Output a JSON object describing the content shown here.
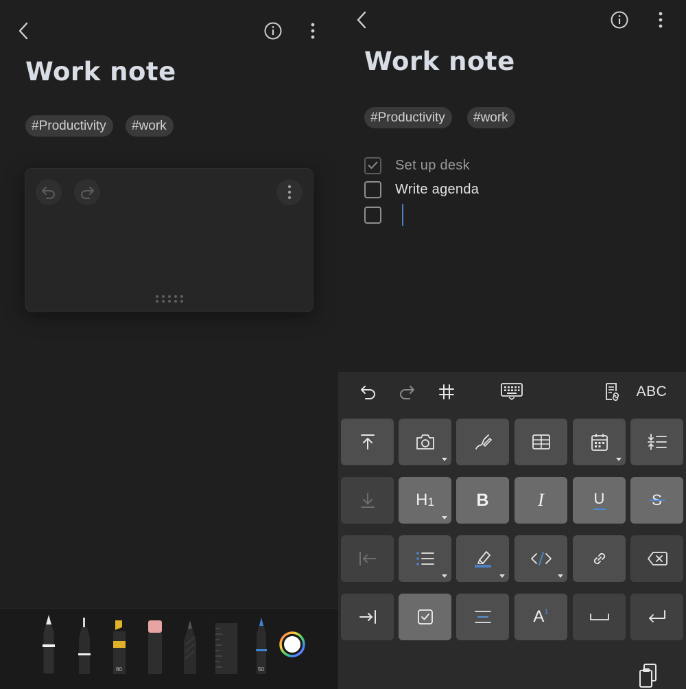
{
  "left_screen": {
    "title": "Work note",
    "tags": [
      "#Productivity",
      "#work"
    ],
    "icons": {
      "back": "back-arrow-icon",
      "info": "info-icon",
      "more": "more-vertical-icon",
      "undo": "undo-icon",
      "redo": "redo-icon",
      "canvas_more": "more-vertical-icon",
      "handle": "drag-handle-icon",
      "palette": "color-palette-icon"
    },
    "pens": [
      {
        "name": "fountain-pen",
        "number": ""
      },
      {
        "name": "fine-liner",
        "number": ""
      },
      {
        "name": "marker",
        "number": "80"
      },
      {
        "name": "eraser",
        "number": ""
      },
      {
        "name": "pencil",
        "number": ""
      },
      {
        "name": "ruler",
        "number": ""
      },
      {
        "name": "ballpoint-pen",
        "number": "50"
      }
    ],
    "colors": {
      "marker": "#e0b22a",
      "eraser": "#e8a3a3",
      "ballpoint": "#3d86d6"
    }
  },
  "right_screen": {
    "title": "Work note",
    "tags": [
      "#Productivity",
      "#work"
    ],
    "checklist": [
      {
        "label": "Set up desk",
        "checked": true
      },
      {
        "label": "Write agenda",
        "checked": false
      },
      {
        "label": "",
        "checked": false
      }
    ],
    "toolbar": {
      "abc_label": "ABC",
      "top_icons": [
        "undo-icon",
        "redo-icon",
        "grid-icon",
        "keyboard-icon",
        "note-link-icon"
      ]
    },
    "keys": {
      "h1_label": "H",
      "h1_sub": "1",
      "bold_label": "B",
      "italic_label": "I",
      "underline_label": "U",
      "strike_label": "S",
      "superscript_label": "A",
      "superscript_sup": "1"
    },
    "accent_color": "#4c8ad6"
  }
}
